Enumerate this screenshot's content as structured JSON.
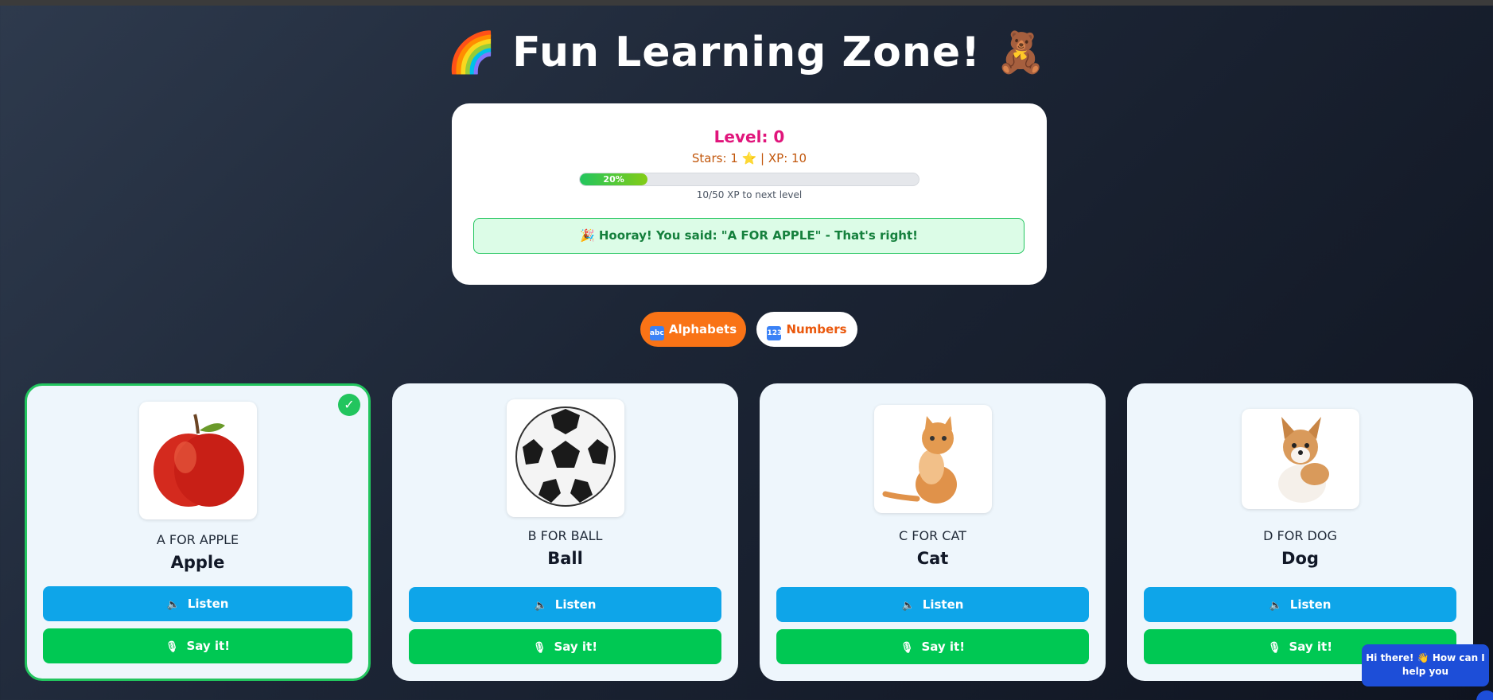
{
  "title": {
    "left_emoji": "🌈",
    "text": "Fun Learning Zone!",
    "right_emoji": "🧸"
  },
  "stats": {
    "level": "Level: 0",
    "stars_xp": "Stars: 1 ⭐ | XP: 10",
    "progress_percent": 20,
    "progress_label": "20%",
    "xp_to_next": "10/50 XP to next level",
    "feedback": "🎉 Hooray! You said: \"A FOR APPLE\" - That's right!"
  },
  "tabs": [
    {
      "label": "Alphabets",
      "icon": "abc-icon",
      "icon_text": "abc",
      "active": true
    },
    {
      "label": "Numbers",
      "icon": "numbers-icon",
      "icon_text": "1234",
      "active": false
    }
  ],
  "cards": [
    {
      "phrase": "A FOR APPLE",
      "word": "Apple",
      "image": "apple-image",
      "completed": true,
      "listen": "Listen",
      "say": "Say it!"
    },
    {
      "phrase": "B FOR BALL",
      "word": "Ball",
      "image": "ball-image",
      "completed": false,
      "listen": "Listen",
      "say": "Say it!"
    },
    {
      "phrase": "C FOR CAT",
      "word": "Cat",
      "image": "cat-image",
      "completed": false,
      "listen": "Listen",
      "say": "Say it!"
    },
    {
      "phrase": "D FOR DOG",
      "word": "Dog",
      "image": "dog-image",
      "completed": false,
      "listen": "Listen",
      "say": "Say it!"
    }
  ],
  "chat": {
    "text": "Hi there! 👋 How can I help you"
  },
  "colors": {
    "accent_orange": "#f97316",
    "level_pink": "#e0157b",
    "listen_blue": "#0ea5e9",
    "say_green": "#00c853"
  }
}
